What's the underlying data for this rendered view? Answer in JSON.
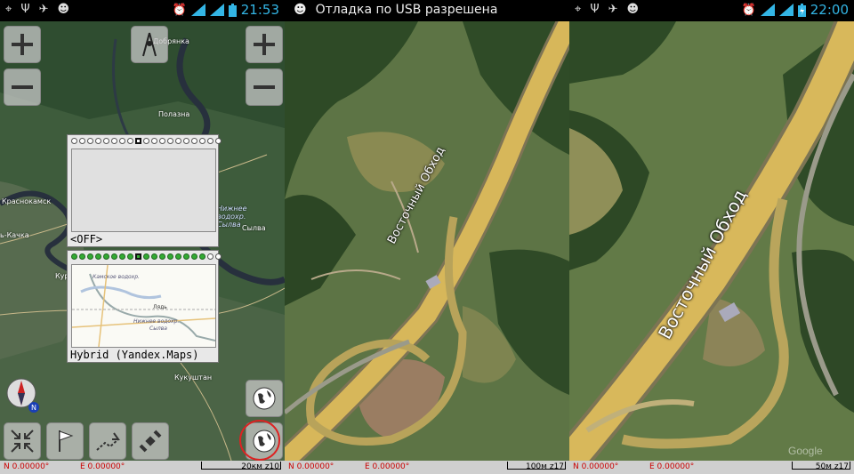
{
  "panel1": {
    "time": "21:53",
    "map_labels": [
      "Добрянка",
      "Полазна",
      "Краснокамск",
      "Сылва",
      "ь-Качка",
      "Кукуштан",
      "Нижнее водохр. Сылва",
      "Кур"
    ],
    "layer_off_label": "<OFF>",
    "layer_hybrid_label": "Hybrid (Yandex.Maps)",
    "preview_labels": [
      "Камское водохр.",
      "Лядь",
      "Нижнее водохр.",
      "Сылва"
    ],
    "coords": {
      "n": "N 0.00000°",
      "e": "E 0.00000°",
      "scale": "20км z10"
    },
    "icons": [
      "zoom-in-icon",
      "zoom-out-icon",
      "compass-arrow-icon",
      "compass-icon",
      "collapse-icon",
      "flag-icon",
      "route-icon",
      "satellite-icon",
      "globe-icon",
      "globe-layers-icon"
    ]
  },
  "panel2": {
    "notification": "Отладка по USB разрешена",
    "road_label": "Восточный Обход",
    "coords": {
      "n": "N 0.00000°",
      "e": "E 0.00000°",
      "scale": "100м z17"
    }
  },
  "panel3": {
    "time": "22:00",
    "road_label": "Восточный Обход",
    "coords": {
      "n": "N 0.00000°",
      "e": "E 0.00000°",
      "scale": "50м z17"
    },
    "watermark": "Google"
  },
  "colors": {
    "accent": "#33b5e5",
    "coord_text": "#cc0000",
    "highlight_circle": "#dd2222"
  }
}
